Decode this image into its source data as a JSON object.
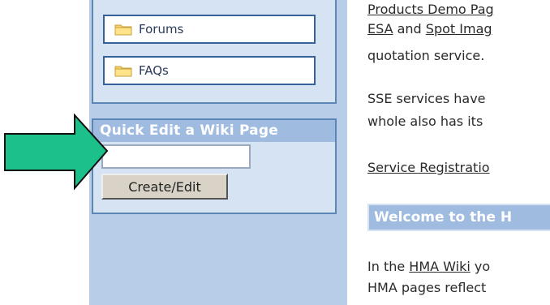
{
  "sidebar": {
    "links": [
      {
        "label": "Forums",
        "icon": "folder-icon"
      },
      {
        "label": "FAQs",
        "icon": "folder-icon"
      }
    ]
  },
  "quick_edit": {
    "title": "Quick Edit a Wiki Page",
    "input_value": "",
    "button_label": "Create/Edit"
  },
  "content": {
    "line1": "Products Demo Pag",
    "line2_link1": "ESA",
    "line2_mid": " and ",
    "line2_link2": "Spot Imag",
    "line3": "quotation service.",
    "line4": "SSE services have",
    "line5": "whole also has its",
    "service_link": "Service Registratio",
    "welcome_title": "Welcome to the H",
    "line6_pre": "In the ",
    "line6_link": "HMA Wiki",
    "line6_post": " yo",
    "line7": "HMA pages reflect"
  },
  "colors": {
    "sidebar_bg": "#b7cde8",
    "panel_title": "#9fbbe0",
    "arrow_fill": "#1cc08a"
  }
}
